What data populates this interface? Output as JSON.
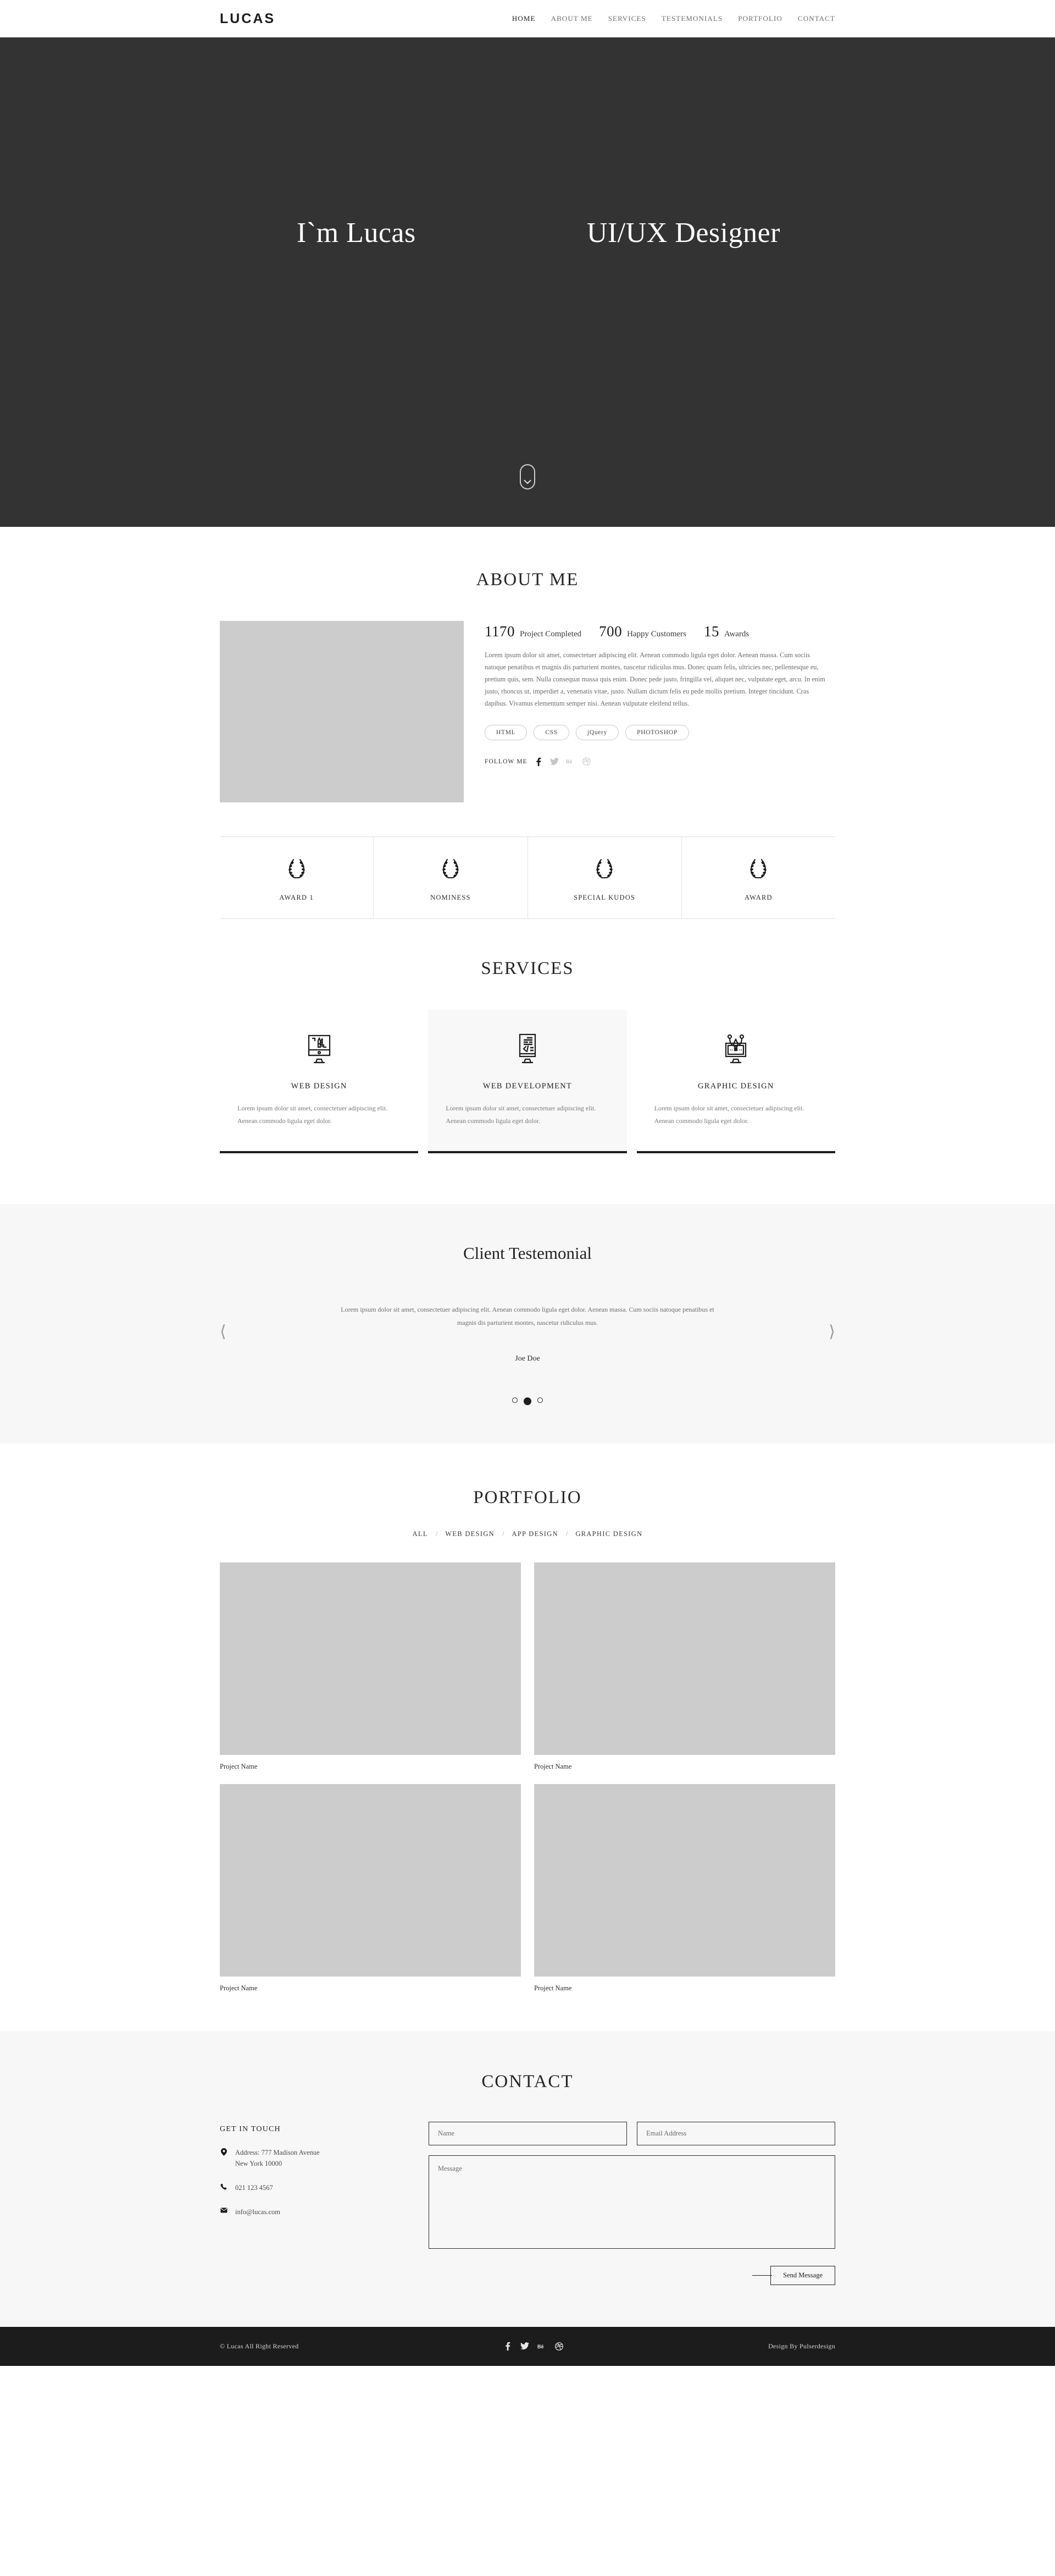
{
  "header": {
    "logo": "LUCAS",
    "nav": [
      {
        "label": "HOME",
        "active": true
      },
      {
        "label": "ABOUT ME",
        "active": false
      },
      {
        "label": "SERVICES",
        "active": false
      },
      {
        "label": "TESTEMONIALS",
        "active": false
      },
      {
        "label": "PORTFOLIO",
        "active": false
      },
      {
        "label": "CONTACT",
        "active": false
      }
    ]
  },
  "hero": {
    "left_title": "I`m Lucas",
    "right_title": "UI/UX Designer",
    "scroll_icon": "mouse-scroll-down-icon",
    "background_color": "#333333"
  },
  "about": {
    "title": "ABOUT ME",
    "photo_placeholder_color": "#cccccc",
    "stats": [
      {
        "value": "1170",
        "label": "Project Completed"
      },
      {
        "value": "700",
        "label": "Happy Customers"
      },
      {
        "value": "15",
        "label": "Awards"
      }
    ],
    "text": "Lorem ipsum dolor sit amet, consectetuer adipiscing elit. Aenean commodo ligula eget dolor. Aenean massa. Cum sociis natoque penatibus et magnis dis parturient montes, nascetur ridiculus mus. Donec quam felis, ultricies nec, pellentesque eu, pretium quis, sem. Nulla consequat massa quis enim. Donec pede justo, fringilla vel, aliquet nec, vulputate eget, arcu. In enim justo, rhoncus ut, imperdiet a, venenatis vitae, justo. Nullam dictum felis eu pede mollis pretium. Integer tincidunt. Cras dapibus. Vivamus elementum semper nisi. Aenean vulputate eleifend tellus.",
    "skills": [
      "HTML",
      "CSS",
      "jQuery",
      "PHOTOSHOP"
    ],
    "follow_label": "FOLLOW ME",
    "socials": [
      "facebook-icon",
      "twitter-icon",
      "behance-icon",
      "dribbble-icon"
    ]
  },
  "awards": {
    "items": [
      {
        "name": "AWARD 1",
        "icon": "laurel-wreath-icon"
      },
      {
        "name": "NOMINESS",
        "icon": "laurel-wreath-icon"
      },
      {
        "name": "SPECIAL KUDOS",
        "icon": "laurel-wreath-icon"
      },
      {
        "name": "AWARD",
        "icon": "laurel-wreath-icon"
      }
    ]
  },
  "services": {
    "title": "SERVICES",
    "cards": [
      {
        "title": "WEB DESIGN",
        "icon": "monitor-design-icon",
        "desc": "Lorem ipsum dolor sit amet, consectetuer adipiscing elit. Aenean commodo ligula eget dolor.",
        "featured": false
      },
      {
        "title": "WEB DEVELOPMENT",
        "icon": "code-window-icon",
        "desc": "Lorem ipsum dolor sit amet, consectetuer adipiscing elit. Aenean commodo ligula eget dolor.",
        "featured": true
      },
      {
        "title": "GRAPHIC DESIGN",
        "icon": "pen-tool-monitor-icon",
        "desc": "Lorem ipsum dolor sit amet, consectetuer adipiscing elit. Aenean commodo ligula eget dolor.",
        "featured": false
      }
    ]
  },
  "testimonial": {
    "title": "Client Testemonial",
    "quote": "Lorem ipsum dolor sit amet, consectetuer adipiscing elit. Aenean commodo ligula eget dolor. Aenean massa. Cum sociis natoque penatibus et magnis dis parturient montes, nascetur ridiculus mus.",
    "author": "Joe Doe",
    "prev_icon": "chevron-left-icon",
    "next_icon": "chevron-right-icon",
    "dots_total": 3,
    "dot_active_index": 1
  },
  "portfolio": {
    "title": "PORTFOLIO",
    "filters": [
      "ALL",
      "WEB DESIGN",
      "APP DESIGN",
      "GRAPHIC DESIGN"
    ],
    "filter_separator": "/",
    "projects": [
      {
        "name": "Project Name"
      },
      {
        "name": "Project Name"
      },
      {
        "name": "Project Name"
      },
      {
        "name": "Project Name"
      }
    ],
    "thumb_placeholder_color": "#cccccc"
  },
  "contact": {
    "title": "CONTACT",
    "get_in_touch": "GET IN TOUCH",
    "address_line1": "Address: 777 Madison Avenue",
    "address_line2": "New York 10000",
    "phone": "021 123 4567",
    "email": "info@lucas.com",
    "address_icon": "map-pin-icon",
    "phone_icon": "phone-icon",
    "email_icon": "envelope-icon",
    "form": {
      "name_placeholder": "Name",
      "email_placeholder": "Email Address",
      "message_placeholder": "Message",
      "submit_label": "Send Message"
    }
  },
  "footer": {
    "copyright": "© Lucas All Right Reserved",
    "credit": "Design By Pulserdesign",
    "socials": [
      "facebook-icon",
      "twitter-icon",
      "behance-icon",
      "dribbble-icon"
    ]
  }
}
